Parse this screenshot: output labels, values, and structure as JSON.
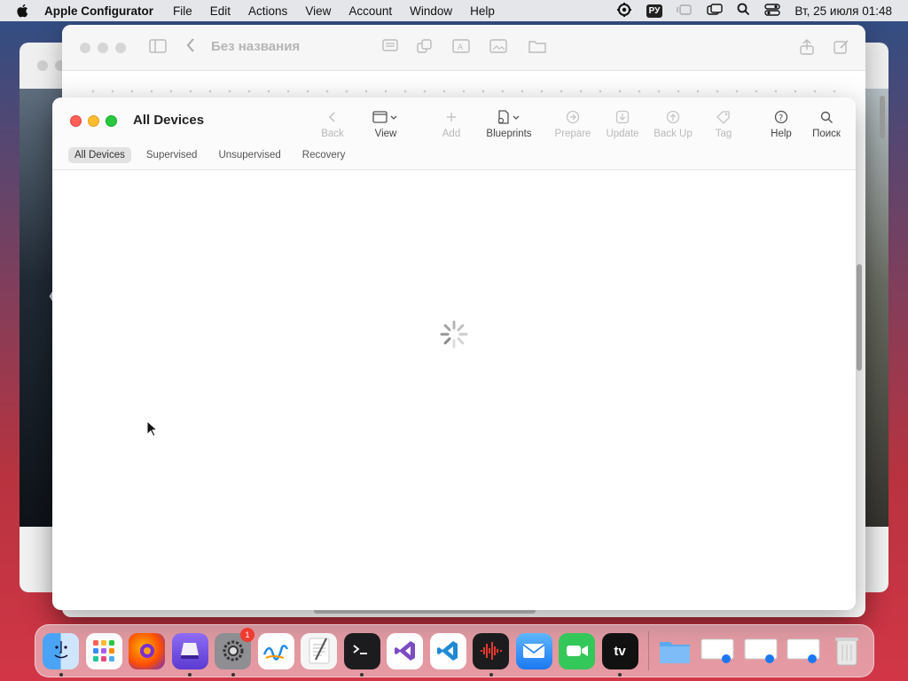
{
  "menubar": {
    "app_name": "Apple Configurator",
    "items": [
      "File",
      "Edit",
      "Actions",
      "View",
      "Account",
      "Window",
      "Help"
    ],
    "input_source": "РУ",
    "clock": "Вт, 25 июля  01:48"
  },
  "notes_window": {
    "title": "Без названия"
  },
  "main_window": {
    "title": "All Devices",
    "toolbar": {
      "back": "Back",
      "view": "View",
      "add": "Add",
      "blueprints": "Blueprints",
      "prepare": "Prepare",
      "update": "Update",
      "backup": "Back Up",
      "tag": "Tag",
      "help": "Help",
      "search": "Поиск"
    },
    "tabs": [
      "All Devices",
      "Supervised",
      "Unsupervised",
      "Recovery"
    ],
    "selected_tab": "All Devices",
    "status": "loading"
  },
  "dock": {
    "apps": [
      "Finder",
      "Launchpad",
      "Firefox",
      "Apple Configurator",
      "System Settings",
      "Freeform",
      "TextEdit",
      "Terminal",
      "Visual Studio",
      "Visual Studio Code",
      "Voice Memos",
      "Mail",
      "FaceTime",
      "Apple TV",
      "Downloads",
      "Window 1",
      "Window 2",
      "Window 3",
      "Trash"
    ],
    "settings_badge": "1"
  },
  "colors": {
    "close": "#fe5f57",
    "minimize": "#febc2e",
    "zoom": "#28c840",
    "accent": "#1f6feb"
  }
}
